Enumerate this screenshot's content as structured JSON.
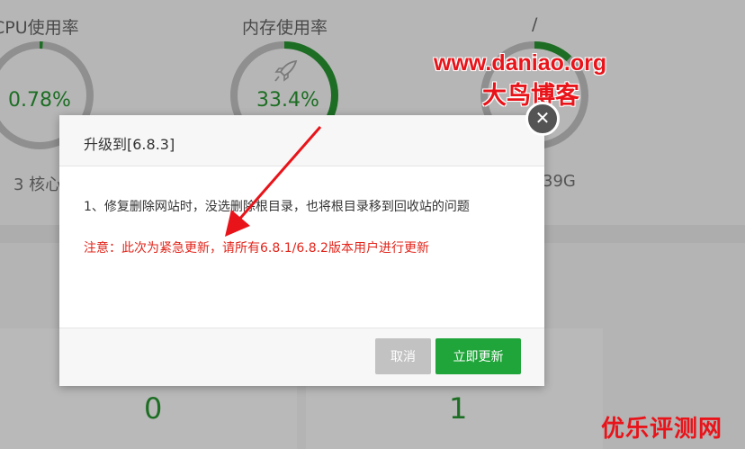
{
  "dashboard": {
    "gauges": [
      {
        "title": "CPU使用率",
        "value": "0.78%",
        "sub": "3 核心",
        "progress": 0.0078
      },
      {
        "title": "内存使用率",
        "value": "33.4%",
        "sub": "",
        "icon": "rocket-icon",
        "progress": 0.334
      },
      {
        "title": "/",
        "value": "",
        "sub": "39G",
        "progress": 0.12
      }
    ],
    "stats": [
      "0",
      "1"
    ]
  },
  "modal": {
    "title": "升级到[6.8.3]",
    "description": "1、修复删除网站时，没选删除根目录，也将根目录移到回收站的问题",
    "note": "注意：此次为紧急更新，请所有6.8.1/6.8.2版本用户进行更新",
    "cancel_label": "取消",
    "update_label": "立即更新",
    "close_glyph": "✕"
  },
  "watermark": {
    "url": "www.daniao.org",
    "name": "大鸟博客",
    "corner": "优乐评测网"
  },
  "colors": {
    "accent_green": "#20a53a",
    "note_red": "#e1251b",
    "arrow_red": "#e8141a",
    "gauge_green": "#1d6e24"
  }
}
